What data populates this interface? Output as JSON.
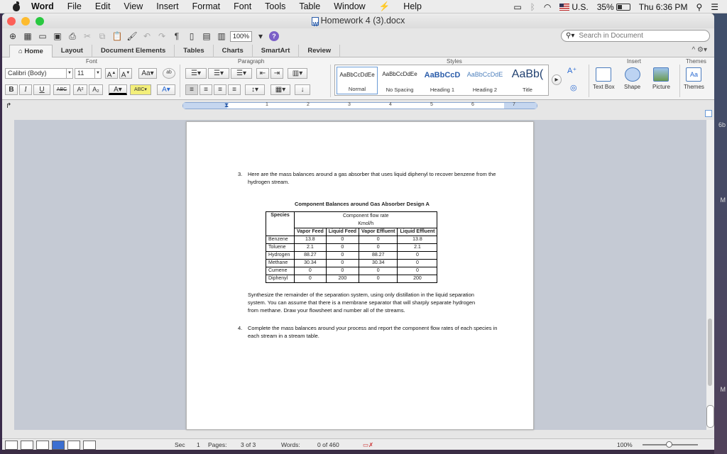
{
  "menubar": {
    "app": "Word",
    "items": [
      "File",
      "Edit",
      "View",
      "Insert",
      "Format",
      "Font",
      "Tools",
      "Table",
      "Window",
      "Help"
    ],
    "input_source": "U.S.",
    "battery": "35%",
    "clock": "Thu 6:36 PM"
  },
  "window": {
    "title": "Homework 4 (3).docx",
    "zoom": "100%",
    "help": "?",
    "search_placeholder": "Search in Document"
  },
  "ribbon_tabs": [
    "Home",
    "Layout",
    "Document Elements",
    "Tables",
    "Charts",
    "SmartArt",
    "Review"
  ],
  "ribbon": {
    "groups": {
      "font": "Font",
      "paragraph": "Paragraph",
      "styles": "Styles",
      "insert": "Insert",
      "themes": "Themes"
    },
    "font_name": "Calibri (Body)",
    "font_size": "11",
    "bold": "B",
    "italic": "I",
    "underline": "U",
    "strike": "ABC",
    "superscript": "A²",
    "subscript": "A₂",
    "styles": [
      {
        "sample": "AaBbCcDdEe",
        "name": "Normal"
      },
      {
        "sample": "AaBbCcDdEe",
        "name": "No Spacing"
      },
      {
        "sample": "AaBbCcD",
        "name": "Heading 1"
      },
      {
        "sample": "AaBbCcDdE",
        "name": "Heading 2"
      },
      {
        "sample": "AaBb(",
        "name": "Title"
      }
    ],
    "insert_items": [
      "Text Box",
      "Shape",
      "Picture"
    ],
    "themes_label": "Themes"
  },
  "ruler_numbers": [
    "1",
    "2",
    "3",
    "4",
    "5",
    "6",
    "7"
  ],
  "document": {
    "q3_number": "3.",
    "q3_text": "Here are the mass balances around a gas absorber that uses liquid diphenyl to recover benzene from the hydrogen stream.",
    "table_caption": "Component Balances around Gas Absorber Design A",
    "table": {
      "species_header": "Species",
      "flow_header": "Component flow rate",
      "unit": "Kmol/h",
      "columns": [
        "Vapor Feed",
        "Liquid Feed",
        "Vapor Effluent",
        "Liquid Effluent"
      ],
      "rows": [
        {
          "species": "Benzene",
          "values": [
            "13.8",
            "0",
            "0",
            "13.8"
          ]
        },
        {
          "species": "Toluene",
          "values": [
            "2.1",
            "0",
            "0",
            "2.1"
          ]
        },
        {
          "species": "Hydrogen",
          "values": [
            "88.27",
            "0",
            "88.27",
            "0"
          ]
        },
        {
          "species": "Methane",
          "values": [
            "30.34",
            "0",
            "30.34",
            "0"
          ]
        },
        {
          "species": "Cumene",
          "values": [
            "0",
            "0",
            "0",
            "0"
          ]
        },
        {
          "species": "Diphenyl",
          "values": [
            "0",
            "200",
            "0",
            "200"
          ]
        }
      ]
    },
    "synth_text": "Synthesize the remainder of the separation system, using only distillation in the liquid separation system.  You can assume that there is a membrane separator that will sharply separate hydrogen from methane.  Draw your flowsheet and number all of the streams.",
    "q4_number": "4.",
    "q4_text": "Complete the mass balances around your process and report the component flow rates of each species in each stream in a stream table."
  },
  "statusbar": {
    "sec_label": "Sec",
    "sec_value": "1",
    "pages_label": "Pages:",
    "pages_value": "3 of 3",
    "words_label": "Words:",
    "words_value": "0 of 460",
    "zoom": "100%"
  },
  "desktop_labels": [
    "6b",
    "M",
    "M"
  ]
}
